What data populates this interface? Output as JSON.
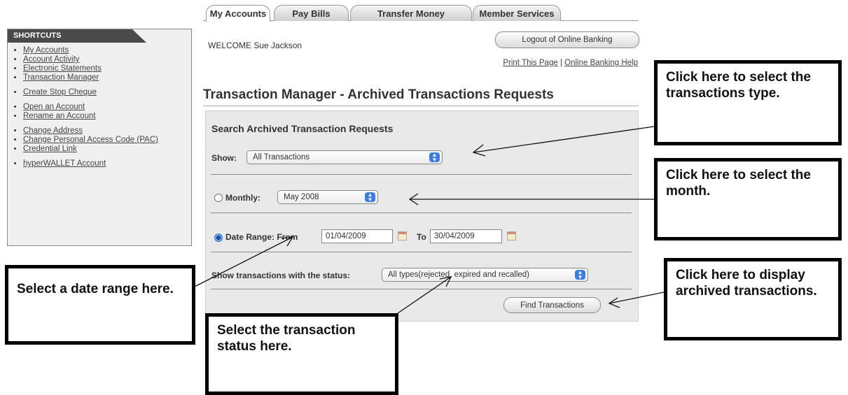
{
  "tabs": [
    {
      "label": "My Accounts",
      "active": true
    },
    {
      "label": "Pay Bills",
      "active": false
    },
    {
      "label": "Transfer Money",
      "active": false
    },
    {
      "label": "Member Services",
      "active": false
    }
  ],
  "shortcuts": {
    "header": "SHORTCUTS",
    "items": [
      {
        "label": "My Accounts"
      },
      {
        "label": "Account Activity"
      },
      {
        "label": "Electronic Statements"
      },
      {
        "label": "Transaction Manager"
      },
      {
        "label": "Create Stop Cheque"
      },
      {
        "label": "Open an Account"
      },
      {
        "label": "Rename an Account"
      },
      {
        "label": "Change Address"
      },
      {
        "label": "Change Personal Access Code (PAC)"
      },
      {
        "label": "Credential Link"
      },
      {
        "label": "hyperWALLET Account"
      }
    ]
  },
  "header": {
    "welcome": "WELCOME Sue Jackson",
    "logout_label": "Logout of Online Banking",
    "print_link": "Print This Page",
    "separator": "|",
    "help_link": "Online Banking Help"
  },
  "page_title": "Transaction Manager - Archived Transactions Requests",
  "search": {
    "title": "Search Archived Transaction Requests",
    "show_label": "Show:",
    "show_value": "All Transactions",
    "monthly_label": "Monthly:",
    "monthly_value": "May 2008",
    "date_range_label": "Date Range: From",
    "from_value": "01/04/2009",
    "to_label": "To",
    "to_value": "30/04/2009",
    "status_label": "Show transactions with the status:",
    "status_value": "All types(rejected, expired and recalled)",
    "find_label": "Find Transactions"
  },
  "callouts": {
    "type": "Click here to select the transactions type.",
    "month": "Click here to select the month.",
    "date_range": "Select a date range here.",
    "status": "Select the transaction status here.",
    "display": "Click here to display archived transactions."
  },
  "colors": {
    "select_arrow": "#3d7de0",
    "panel_bg": "#e9e9e9",
    "shortcuts_header": "#4a4a4a"
  }
}
